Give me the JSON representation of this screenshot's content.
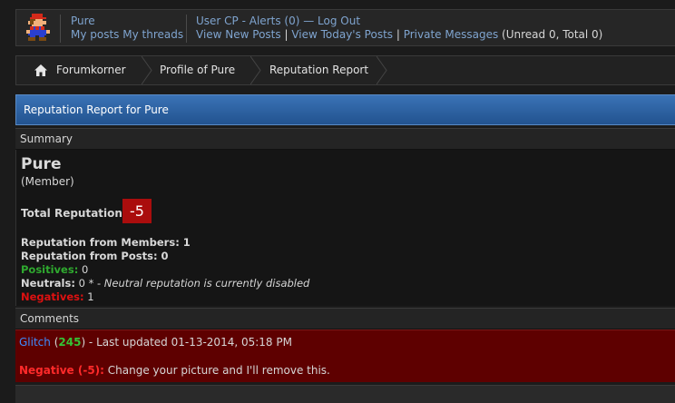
{
  "userbar": {
    "username": "Pure",
    "my_posts": "My posts",
    "my_threads": "My threads",
    "user_cp": "User CP",
    "dash1": " - ",
    "alerts": "Alerts (0)",
    "dash2": " — ",
    "logout": "Log Out",
    "view_new_posts": "View New Posts",
    "pipe1": " | ",
    "view_todays_posts": "View Today's Posts",
    "pipe2": " | ",
    "private_messages": "Private Messages",
    "pm_counts": " (Unread 0, Total 0)"
  },
  "breadcrumb": {
    "items": [
      {
        "label": "Forumkorner"
      },
      {
        "label": "Profile of Pure"
      },
      {
        "label": "Reputation Report"
      }
    ]
  },
  "header": {
    "title": "Reputation Report for Pure"
  },
  "summary": {
    "section_title": "Summary",
    "username": "Pure",
    "user_title": "(Member)",
    "total_rep_label": "Total Reputation:",
    "total_rep_value": "-5",
    "from_members_label": "Reputation from Members:",
    "from_members_value": " 1",
    "from_posts_label": "Reputation from Posts:",
    "from_posts_value": " 0",
    "positives_label": "Positives:",
    "positives_value": " 0",
    "neutrals_label": "Neutrals:",
    "neutrals_value": " 0 * - ",
    "neutrals_note": "Neutral reputation is currently disabled",
    "negatives_label": "Negatives:",
    "negatives_value": " 1"
  },
  "comments": {
    "section_title": "Comments",
    "items": [
      {
        "author": "Glitch",
        "open_paren": " (",
        "author_rep": "245",
        "close_rest": ") - Last updated 01-13-2014, 05:18 PM",
        "rating": "Negative (-5):",
        "text": " Change your picture and I'll remove this."
      }
    ]
  },
  "colors": {
    "header_blue": "#2a5f9e",
    "rep_badge": "#aa0d0d",
    "comment_bg": "#5e0000",
    "positive": "#2fa92f",
    "negative": "#d11111"
  },
  "icons": {
    "avatar": "pixel-mario-avatar",
    "home": "home-icon"
  }
}
